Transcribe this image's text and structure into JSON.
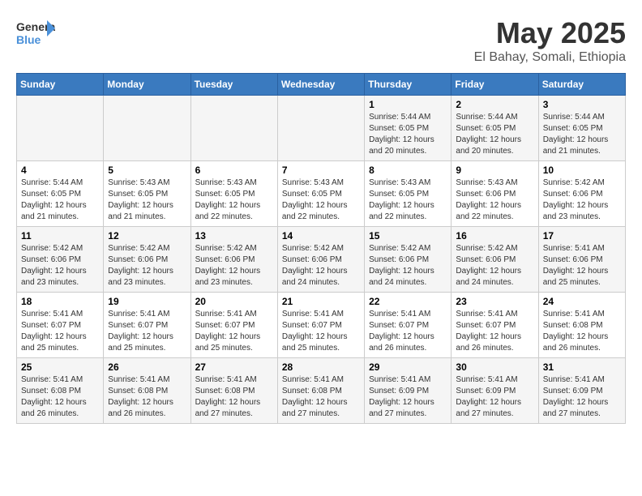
{
  "header": {
    "logo_general": "General",
    "logo_blue": "Blue",
    "month_title": "May 2025",
    "location": "El Bahay, Somali, Ethiopia"
  },
  "weekdays": [
    "Sunday",
    "Monday",
    "Tuesday",
    "Wednesday",
    "Thursday",
    "Friday",
    "Saturday"
  ],
  "weeks": [
    [
      {
        "day": "",
        "info": ""
      },
      {
        "day": "",
        "info": ""
      },
      {
        "day": "",
        "info": ""
      },
      {
        "day": "",
        "info": ""
      },
      {
        "day": "1",
        "info": "Sunrise: 5:44 AM\nSunset: 6:05 PM\nDaylight: 12 hours\nand 20 minutes."
      },
      {
        "day": "2",
        "info": "Sunrise: 5:44 AM\nSunset: 6:05 PM\nDaylight: 12 hours\nand 20 minutes."
      },
      {
        "day": "3",
        "info": "Sunrise: 5:44 AM\nSunset: 6:05 PM\nDaylight: 12 hours\nand 21 minutes."
      }
    ],
    [
      {
        "day": "4",
        "info": "Sunrise: 5:44 AM\nSunset: 6:05 PM\nDaylight: 12 hours\nand 21 minutes."
      },
      {
        "day": "5",
        "info": "Sunrise: 5:43 AM\nSunset: 6:05 PM\nDaylight: 12 hours\nand 21 minutes."
      },
      {
        "day": "6",
        "info": "Sunrise: 5:43 AM\nSunset: 6:05 PM\nDaylight: 12 hours\nand 22 minutes."
      },
      {
        "day": "7",
        "info": "Sunrise: 5:43 AM\nSunset: 6:05 PM\nDaylight: 12 hours\nand 22 minutes."
      },
      {
        "day": "8",
        "info": "Sunrise: 5:43 AM\nSunset: 6:05 PM\nDaylight: 12 hours\nand 22 minutes."
      },
      {
        "day": "9",
        "info": "Sunrise: 5:43 AM\nSunset: 6:06 PM\nDaylight: 12 hours\nand 22 minutes."
      },
      {
        "day": "10",
        "info": "Sunrise: 5:42 AM\nSunset: 6:06 PM\nDaylight: 12 hours\nand 23 minutes."
      }
    ],
    [
      {
        "day": "11",
        "info": "Sunrise: 5:42 AM\nSunset: 6:06 PM\nDaylight: 12 hours\nand 23 minutes."
      },
      {
        "day": "12",
        "info": "Sunrise: 5:42 AM\nSunset: 6:06 PM\nDaylight: 12 hours\nand 23 minutes."
      },
      {
        "day": "13",
        "info": "Sunrise: 5:42 AM\nSunset: 6:06 PM\nDaylight: 12 hours\nand 23 minutes."
      },
      {
        "day": "14",
        "info": "Sunrise: 5:42 AM\nSunset: 6:06 PM\nDaylight: 12 hours\nand 24 minutes."
      },
      {
        "day": "15",
        "info": "Sunrise: 5:42 AM\nSunset: 6:06 PM\nDaylight: 12 hours\nand 24 minutes."
      },
      {
        "day": "16",
        "info": "Sunrise: 5:42 AM\nSunset: 6:06 PM\nDaylight: 12 hours\nand 24 minutes."
      },
      {
        "day": "17",
        "info": "Sunrise: 5:41 AM\nSunset: 6:06 PM\nDaylight: 12 hours\nand 25 minutes."
      }
    ],
    [
      {
        "day": "18",
        "info": "Sunrise: 5:41 AM\nSunset: 6:07 PM\nDaylight: 12 hours\nand 25 minutes."
      },
      {
        "day": "19",
        "info": "Sunrise: 5:41 AM\nSunset: 6:07 PM\nDaylight: 12 hours\nand 25 minutes."
      },
      {
        "day": "20",
        "info": "Sunrise: 5:41 AM\nSunset: 6:07 PM\nDaylight: 12 hours\nand 25 minutes."
      },
      {
        "day": "21",
        "info": "Sunrise: 5:41 AM\nSunset: 6:07 PM\nDaylight: 12 hours\nand 25 minutes."
      },
      {
        "day": "22",
        "info": "Sunrise: 5:41 AM\nSunset: 6:07 PM\nDaylight: 12 hours\nand 26 minutes."
      },
      {
        "day": "23",
        "info": "Sunrise: 5:41 AM\nSunset: 6:07 PM\nDaylight: 12 hours\nand 26 minutes."
      },
      {
        "day": "24",
        "info": "Sunrise: 5:41 AM\nSunset: 6:08 PM\nDaylight: 12 hours\nand 26 minutes."
      }
    ],
    [
      {
        "day": "25",
        "info": "Sunrise: 5:41 AM\nSunset: 6:08 PM\nDaylight: 12 hours\nand 26 minutes."
      },
      {
        "day": "26",
        "info": "Sunrise: 5:41 AM\nSunset: 6:08 PM\nDaylight: 12 hours\nand 26 minutes."
      },
      {
        "day": "27",
        "info": "Sunrise: 5:41 AM\nSunset: 6:08 PM\nDaylight: 12 hours\nand 27 minutes."
      },
      {
        "day": "28",
        "info": "Sunrise: 5:41 AM\nSunset: 6:08 PM\nDaylight: 12 hours\nand 27 minutes."
      },
      {
        "day": "29",
        "info": "Sunrise: 5:41 AM\nSunset: 6:09 PM\nDaylight: 12 hours\nand 27 minutes."
      },
      {
        "day": "30",
        "info": "Sunrise: 5:41 AM\nSunset: 6:09 PM\nDaylight: 12 hours\nand 27 minutes."
      },
      {
        "day": "31",
        "info": "Sunrise: 5:41 AM\nSunset: 6:09 PM\nDaylight: 12 hours\nand 27 minutes."
      }
    ]
  ]
}
